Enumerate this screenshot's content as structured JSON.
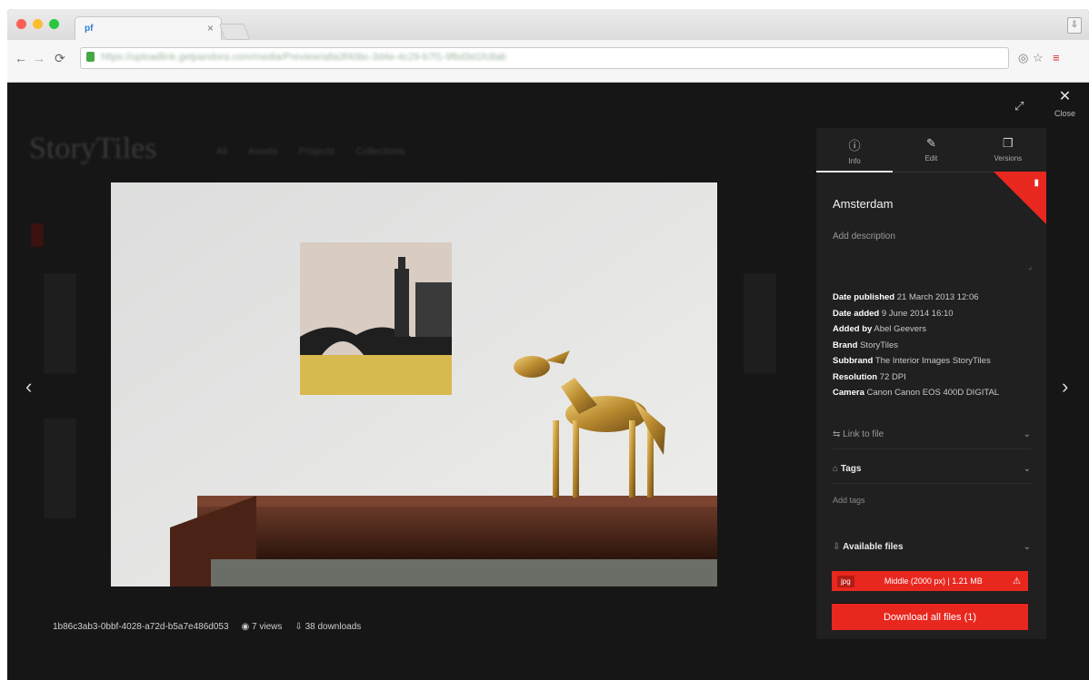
{
  "browser": {
    "tab_title": "",
    "tab_favicon": "pf",
    "url": "https://uploadlink.getpandora.com/media/Preview/a8a3f40bc-3d4e-4c29-b7f1-9fbd3d1fc8ab",
    "nav": {
      "back": "←",
      "forward": "→",
      "reload": "⟳"
    }
  },
  "background": {
    "brand": "StoryTiles",
    "nav_items": "All Assets  Projects  Collections"
  },
  "viewer": {
    "close_label": "Close",
    "prev_arrow": "‹",
    "next_arrow": "›",
    "expand_icon": "⤢",
    "file_id": "1b86c3ab3-0bbf-4028-a72d-b5a7e486d053",
    "views": "7 views",
    "downloads": "38 downloads"
  },
  "panel": {
    "tabs": [
      {
        "label": "Info",
        "icon": "info-icon"
      },
      {
        "label": "Edit",
        "icon": "edit-icon"
      },
      {
        "label": "Versions",
        "icon": "versions-icon"
      }
    ],
    "title": "Amsterdam",
    "description_placeholder": "Add description",
    "details": [
      {
        "label": "Date published",
        "value": "21 March 2013 12:06"
      },
      {
        "label": "Date added",
        "value": "9 June 2014 16:10"
      },
      {
        "label": "Added by",
        "value": "Abel Geevers"
      },
      {
        "label": "Brand",
        "value": "StoryTiles"
      },
      {
        "label": "Subbrand",
        "value": "The Interior Images StoryTiles"
      },
      {
        "label": "Resolution",
        "value": "72 DPI"
      },
      {
        "label": "Camera",
        "value": "Canon Canon EOS 400D DIGITAL"
      }
    ],
    "sections": {
      "link": "Link to file",
      "tags": "Tags",
      "add_tags": "Add tags",
      "available_files": "Available files"
    },
    "file_button": {
      "type": "jpg",
      "label": "Middle (2000 px) | 1.21 MB"
    },
    "download_all": "Download all files (1)"
  },
  "colors": {
    "accent": "#e8271f",
    "panel": "#202020",
    "page": "#161616"
  }
}
